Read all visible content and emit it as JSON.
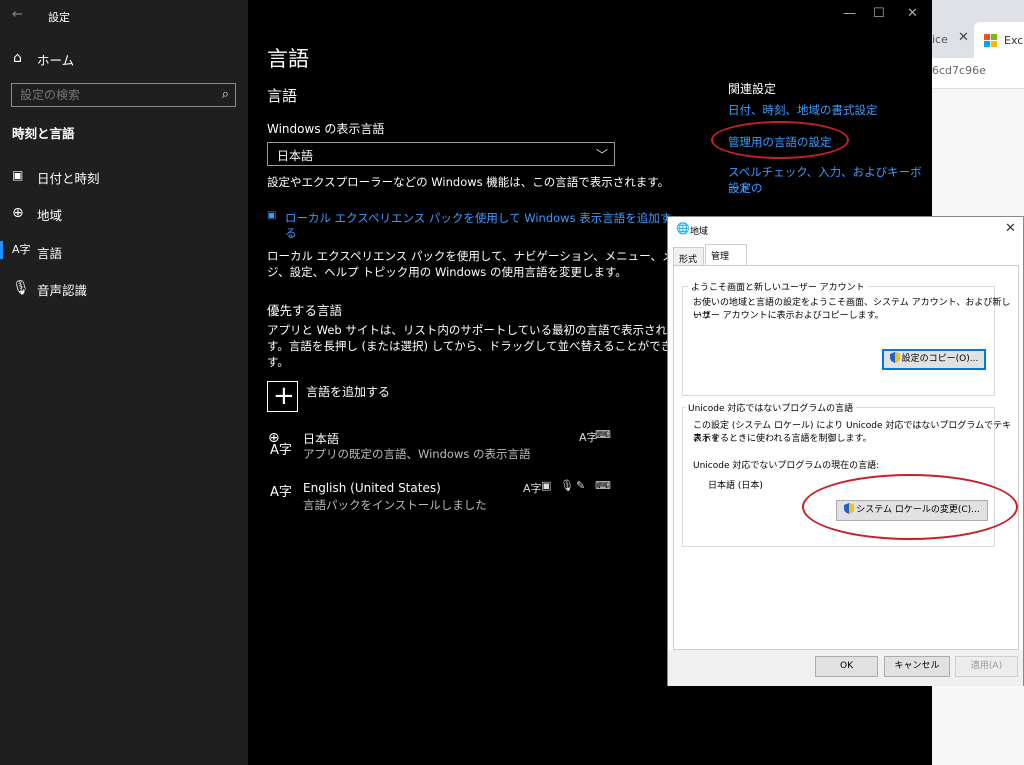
{
  "settings": {
    "title": "設定",
    "nav": {
      "home": "ホーム",
      "search_placeholder": "設定の検索",
      "section": "時刻と言語",
      "items": [
        {
          "label": "日付と時刻",
          "icon": "calendar-icon"
        },
        {
          "label": "地域",
          "icon": "globe-icon"
        },
        {
          "label": "言語",
          "icon": "language-icon",
          "selected": true
        },
        {
          "label": "音声認識",
          "icon": "microphone-icon"
        }
      ]
    },
    "main": {
      "page_title": "言語",
      "subtitle": "言語",
      "display_lang_label": "Windows の表示言語",
      "display_lang_value": "日本語",
      "display_lang_desc": "設定やエクスプローラーなどの Windows 機能は、この言語で表示されます。",
      "lxp_link_1": "ローカル エクスペリエンス パックを使用して Windows 表示言語を追加す",
      "lxp_link_2": "る",
      "lxp_desc_1": "ローカル エクスペリエンス パックを使用して、ナビゲーション、メニュー、メッセー",
      "lxp_desc_2": "ジ、設定、ヘルプ トピック用の Windows の使用言語を変更します。",
      "preferred_title": "優先する言語",
      "preferred_desc_1": "アプリと Web サイトは、リスト内のサポートしている最初の言語で表示されま",
      "preferred_desc_2": "す。言語を長押し (または選択) してから、ドラッグして並べ替えることができま",
      "preferred_desc_3": "す。",
      "add_language": "言語を追加する",
      "languages": [
        {
          "name": "日本語",
          "desc": "アプリの既定の言語、Windows の表示言語"
        },
        {
          "name": "English (United States)",
          "desc": "言語パックをインストールしました"
        }
      ]
    },
    "related": {
      "title": "関連設定",
      "links": [
        "日付、時刻、地域の書式設定",
        "管理用の言語の設定",
        "スペルチェック、入力、およびキーボードの",
        "設定"
      ]
    }
  },
  "dialog": {
    "title": "地域",
    "tabs": [
      "形式",
      "管理"
    ],
    "welcome_group": {
      "title": "ようこそ画面と新しいユーザー アカウント",
      "desc_1": "お使いの地域と言語の設定をようこそ画面、システム アカウント、および新しいユ",
      "desc_2": "ーザー アカウントに表示およびコピーします。",
      "button": "設定のコピー(O)..."
    },
    "unicode_group": {
      "title": "Unicode 対応ではないプログラムの言語",
      "desc_1": "この設定 (システム ロケール) により Unicode 対応ではないプログラムでテキストを",
      "desc_2": "表示するときに使われる言語を制御します。",
      "current_label": "Unicode 対応でないプログラムの現在の言語:",
      "current_value": "日本語 (日本)",
      "button": "システム ロケールの変更(C)..."
    },
    "ok": "OK",
    "cancel": "キャンセル",
    "apply": "適用(A)"
  },
  "browser": {
    "tab1": "ice",
    "tab2": "Excel",
    "address": "6cd7c96e"
  },
  "colors": {
    "link": "#3b9cff",
    "accent": "#1e90ff",
    "annotation": "#c8202a"
  }
}
